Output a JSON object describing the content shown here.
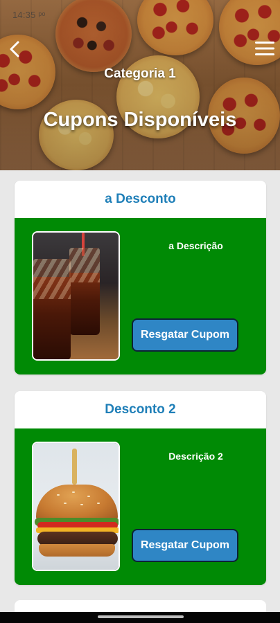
{
  "status_bar": {
    "time": "14:35 ᵖᵒ"
  },
  "header": {
    "category": "Categoria 1",
    "title": "Cupons Disponíveis"
  },
  "coupons": [
    {
      "title": "a Desconto",
      "description": "a Descrição",
      "button_label": "Resgatar Cupom",
      "image": "soda-drinks-image"
    },
    {
      "title": "Desconto 2",
      "description": "Descrição 2",
      "button_label": "Resgatar Cupom",
      "image": "burger-image"
    }
  ],
  "colors": {
    "card_body": "#008a05",
    "title_blue": "#1f7fb8",
    "button_blue": "#2f86c5"
  },
  "icons": {
    "back": "chevron-left-icon",
    "menu": "hamburger-menu-icon"
  }
}
